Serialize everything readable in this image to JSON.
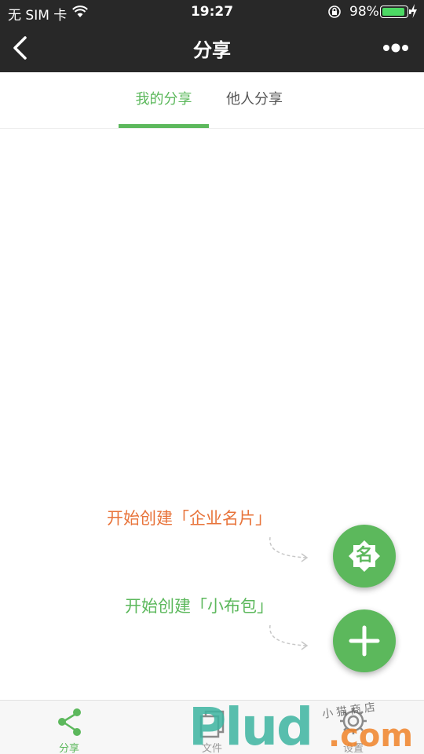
{
  "status_bar": {
    "carrier": "无 SIM 卡",
    "time": "19:27",
    "battery_percent": "98%",
    "battery_level": 0.98
  },
  "nav": {
    "title": "分享",
    "back_icon": "chevron-left-icon",
    "more_icon": "more-dots-icon"
  },
  "tabs": [
    {
      "label": "我的分享",
      "active": true
    },
    {
      "label": "他人分享",
      "active": false
    }
  ],
  "prompts": {
    "card": "开始创建「企业名片」",
    "bag": "开始创建「小布包」"
  },
  "fabs": {
    "card_badge": "名",
    "add_icon": "plus-icon"
  },
  "tab_bar": [
    {
      "label": "分享",
      "icon": "share-icon",
      "active": true
    },
    {
      "label": "文件",
      "icon": "files-icon",
      "active": false
    },
    {
      "label": "设置",
      "icon": "gear-icon",
      "active": false
    }
  ],
  "watermark": {
    "main": "Plud",
    "suffix": ".com",
    "script": "小猫商店"
  },
  "colors": {
    "accent_green": "#5cb85c",
    "accent_orange": "#e8743b",
    "bar_dark": "#282828"
  }
}
